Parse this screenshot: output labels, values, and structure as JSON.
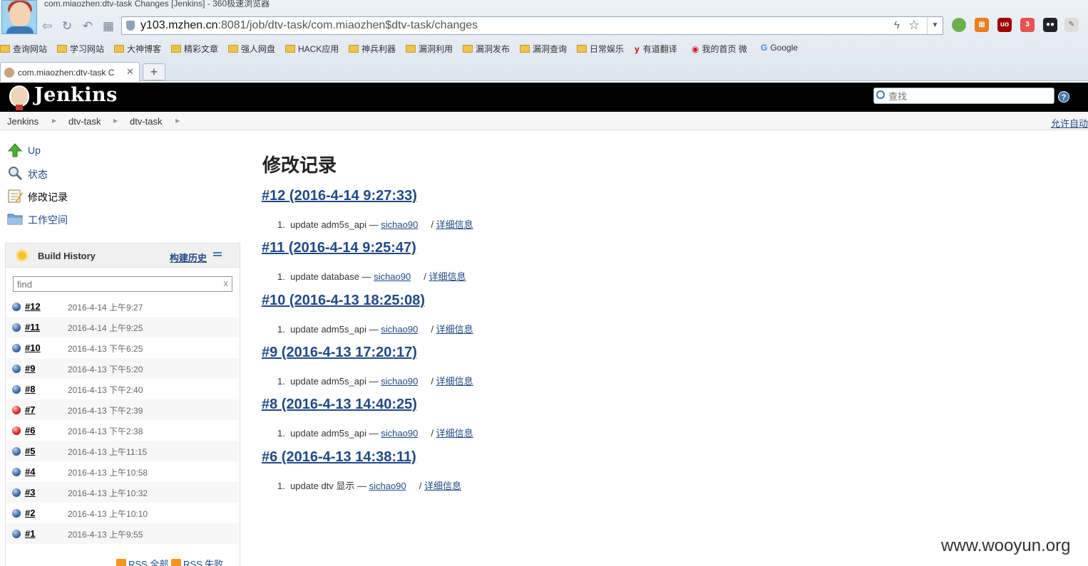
{
  "browser": {
    "window_title": "com.miaozhen:dtv-task Changes [Jenkins] - 360极速浏览器",
    "url_host": "y103.mzhen.cn",
    "url_rest": ":8081/job/dtv-task/com.miaozhen$dtv-task/changes",
    "tab_title": "com.miaozhen:dtv-task C",
    "new_tab_label": "+",
    "bookmarks": [
      "查询网站",
      "学习网站",
      "大神博客",
      "精彩文章",
      "强人网盘",
      "HACK应用",
      "神兵利器",
      "漏洞利用",
      "漏洞发布",
      "漏洞查询",
      "日常娱乐",
      "有道翻译",
      "我的首页 微",
      "Google"
    ]
  },
  "jenkins": {
    "title": "Jenkins",
    "search_placeholder": "查找",
    "help": "?"
  },
  "breadcrumb": [
    "Jenkins",
    "dtv-task",
    "dtv-task"
  ],
  "auto_refresh": "允许自动",
  "sidebar": {
    "tasks": [
      {
        "label": "Up",
        "icon": "up-arrow-icon"
      },
      {
        "label": "状态",
        "icon": "magnifier-icon"
      },
      {
        "label": "修改记录",
        "icon": "notepad-icon"
      },
      {
        "label": "工作空间",
        "icon": "folder-icon"
      }
    ]
  },
  "build_history": {
    "title": "Build History",
    "trend_link": "构建历史",
    "filter_placeholder": "find",
    "clear": "x",
    "builds": [
      {
        "num": "#12",
        "date": "2016-4-14 上午9:27",
        "status": "blue"
      },
      {
        "num": "#11",
        "date": "2016-4-14 上午9:25",
        "status": "blue"
      },
      {
        "num": "#10",
        "date": "2016-4-13 下午6:25",
        "status": "blue"
      },
      {
        "num": "#9",
        "date": "2016-4-13 下午5:20",
        "status": "blue"
      },
      {
        "num": "#8",
        "date": "2016-4-13 下午2:40",
        "status": "blue"
      },
      {
        "num": "#7",
        "date": "2016-4-13 下午2:39",
        "status": "red"
      },
      {
        "num": "#6",
        "date": "2016-4-13 下午2:38",
        "status": "red"
      },
      {
        "num": "#5",
        "date": "2016-4-13 上午11:15",
        "status": "blue"
      },
      {
        "num": "#4",
        "date": "2016-4-13 上午10:58",
        "status": "blue"
      },
      {
        "num": "#3",
        "date": "2016-4-13 上午10:32",
        "status": "blue"
      },
      {
        "num": "#2",
        "date": "2016-4-13 上午10:10",
        "status": "blue"
      },
      {
        "num": "#1",
        "date": "2016-4-13 上午9:55",
        "status": "blue"
      }
    ],
    "rss_all": "RSS 全部",
    "rss_failed": "RSS 失败"
  },
  "main": {
    "title": "修改记录",
    "changesets": [
      {
        "heading": "#12 (2016-4-14 9:27:33)",
        "index": "1.",
        "msg": "update adm5s_api —",
        "author": "sichao90",
        "detail": "详细信息"
      },
      {
        "heading": "#11 (2016-4-14 9:25:47)",
        "index": "1.",
        "msg": "update database —",
        "author": "sichao90",
        "detail": "详细信息"
      },
      {
        "heading": "#10 (2016-4-13 18:25:08)",
        "index": "1.",
        "msg": "update adm5s_api —",
        "author": "sichao90",
        "detail": "详细信息"
      },
      {
        "heading": "#9 (2016-4-13 17:20:17)",
        "index": "1.",
        "msg": "update adm5s_api —",
        "author": "sichao90",
        "detail": "详细信息"
      },
      {
        "heading": "#8 (2016-4-13 14:40:25)",
        "index": "1.",
        "msg": "update adm5s_api —",
        "author": "sichao90",
        "detail": "详细信息"
      },
      {
        "heading": "#6 (2016-4-13 14:38:11)",
        "index": "1.",
        "msg": "update dtv 显示 —",
        "author": "sichao90",
        "detail": "详细信息"
      }
    ]
  },
  "watermark": "www.wooyun.org"
}
